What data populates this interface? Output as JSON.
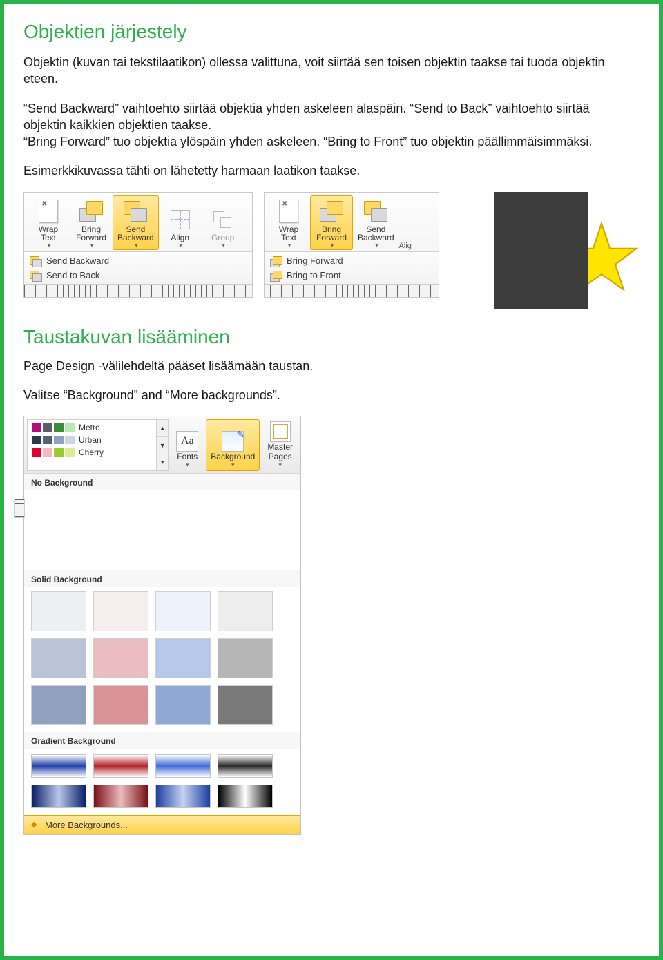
{
  "section1": {
    "heading": "Objektien järjestely",
    "p1": "Objektin (kuvan tai tekstilaatikon) ollessa valittuna, voit siirtää sen toisen objektin taakse tai tuoda objektin eteen.",
    "p2a": "“Send Backward” vaihtoehto siirtää objektia yhden askeleen alaspäin. “Send to Back” vaihtoehto siirtää objektin kaikkien objektien taakse.",
    "p2b": "“Bring Forward” tuo objektia ylöspäin yhden askeleen. “Bring to Front” tuo objektin päällimmäisimmäksi.",
    "p3": "Esimerkkikuvassa tähti on lähetetty harmaan laatikon taakse."
  },
  "ribbonA": {
    "wrap": "Wrap\nText",
    "bringFwd": "Bring\nForward",
    "sendBwd": "Send\nBackward",
    "align": "Align",
    "group": "Group",
    "dd1": "Send Backward",
    "dd2": "Send to Back"
  },
  "ribbonB": {
    "wrap": "Wrap\nText",
    "bringFwd": "Bring\nForward",
    "sendBwd": "Send\nBackward",
    "align": "Alig",
    "dd1": "Bring Forward",
    "dd2": "Bring to Front"
  },
  "section2": {
    "heading": "Taustakuvan lisääminen",
    "p1": "Page Design -välilehdeltä pääset lisäämään taustan.",
    "p2": "Valitse “Background” and “More backgrounds”."
  },
  "design": {
    "schemes": [
      {
        "name": "Metro",
        "c": [
          "#b01079",
          "#5b5b6e",
          "#3a8e3a",
          "#b5e8b5"
        ]
      },
      {
        "name": "Urban",
        "c": [
          "#2b3a4a",
          "#53607a",
          "#8fa2bf",
          "#cfd7e6"
        ]
      },
      {
        "name": "Cherry",
        "c": [
          "#e2002e",
          "#f7b6c0",
          "#9acc2e",
          "#d7ef91"
        ]
      }
    ],
    "fonts": "Fonts",
    "fontsIcon": "Aa",
    "background": "Background",
    "master": "Master\nPages",
    "noBg": "No Background",
    "solidHead": "Solid Background",
    "solidColors": [
      "#edf0f3",
      "#f6edee",
      "#ecf1fa",
      "#ededed",
      "#b9c3d7",
      "#e9bcbf",
      "#b6c9ea",
      "#b6b6b6",
      "#90a1c0",
      "#d99298",
      "#8fa9d6",
      "#7a7a7a"
    ],
    "gradHead": "Gradient Background",
    "gradients": [
      "linear-gradient(#fff,#2140a8,#fff)",
      "linear-gradient(#fff,#b5242c,#fff)",
      "linear-gradient(#fff,#3f6bd6,#fff)",
      "linear-gradient(#fff,#2a2a2a,#fff)",
      "linear-gradient(to right,#0a1f66,#b9c6ea,#0a1f66)",
      "linear-gradient(to right,#7a1016,#e9bcbf,#7a1016)",
      "linear-gradient(to right,#1d3ea0,#c6d3ef,#1d3ea0)",
      "linear-gradient(to right,#000,#fff,#000)"
    ],
    "more": "More Backgrounds..."
  }
}
